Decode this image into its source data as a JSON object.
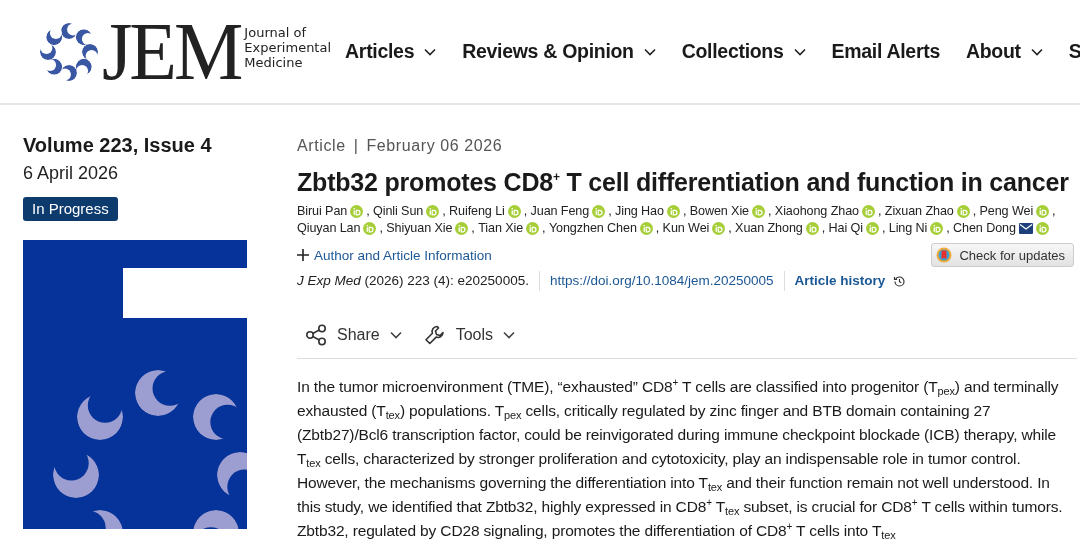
{
  "header": {
    "logo": {
      "mark": "JEM",
      "subtitle": [
        "Journal of",
        "Experimental",
        "Medicine"
      ]
    },
    "nav": [
      {
        "label": "Articles",
        "dropdown": true
      },
      {
        "label": "Reviews & Opinion",
        "dropdown": true
      },
      {
        "label": "Collections",
        "dropdown": true
      },
      {
        "label": "Email Alerts",
        "dropdown": false
      },
      {
        "label": "About",
        "dropdown": true
      },
      {
        "label": "S",
        "dropdown": false
      }
    ]
  },
  "issue": {
    "volume": "Volume 223, Issue 4",
    "date": "6 April 2026",
    "badge": "In Progress"
  },
  "article": {
    "type": "Article",
    "separator": "|",
    "date": "February 06 2026",
    "title": "Zbtb32 promotes CD8$^{+}$ T cell differentiation and function in cancer",
    "authors": [
      {
        "name": "Birui Pan",
        "email": false,
        "separator": ","
      },
      {
        "name": "Qinli Sun",
        "email": false,
        "separator": ","
      },
      {
        "name": "Ruifeng Li",
        "email": false,
        "separator": ","
      },
      {
        "name": "Juan Feng",
        "email": false,
        "separator": ","
      },
      {
        "name": "Jing Hao",
        "email": false,
        "separator": ","
      },
      {
        "name": "Bowen Xie",
        "email": false,
        "separator": ","
      },
      {
        "name": "Xiaohong Zhao",
        "email": false,
        "separator": ","
      },
      {
        "name": "Zixuan Zhao",
        "email": false,
        "separator": ","
      },
      {
        "name": "Peng Wei",
        "email": false,
        "separator": ","
      },
      {
        "name": "Qiuyan Lan",
        "email": false,
        "separator": ","
      },
      {
        "name": "Shiyuan Xie",
        "email": false,
        "separator": ","
      },
      {
        "name": "Tian Xie",
        "email": false,
        "separator": ","
      },
      {
        "name": "Yongzhen Chen",
        "email": false,
        "separator": ","
      },
      {
        "name": "Kun Wei",
        "email": false,
        "separator": ","
      },
      {
        "name": "Xuan Zhong",
        "email": false,
        "separator": ","
      },
      {
        "name": "Hai Qi",
        "email": false,
        "separator": ","
      },
      {
        "name": "Ling Ni",
        "email": false,
        "separator": ","
      },
      {
        "name": "Chen Dong",
        "email": true
      }
    ],
    "author_info": "Author and Article Information",
    "check_updates": "Check for updates",
    "citation": "*J Exp Med* (2026) 223 (4): e20250005.",
    "doi": "https://doi.org/10.1084/jem.20250005",
    "history": "Article history",
    "tools": [
      {
        "label": "Share",
        "kind": "share"
      },
      {
        "label": "Tools",
        "kind": "tools"
      }
    ],
    "abstract": "In the tumor microenvironment (TME), “exhausted” CD8$^{+}$ T cells are classified into progenitor (T$_{pex}$) and terminally exhausted (T$_{tex}$) populations. T$_{pex}$ cells, critically regulated by zinc finger and BTB domain containing 27 (Zbtb27)/Bcl6 transcription factor, could be reinvigorated during immune checkpoint blockade (ICB) therapy, while T$_{tex}$ cells, characterized by stronger proliferation and cytotoxicity, play an indispensable role in tumor control. However, the mechanisms governing the differentiation into T$_{tex}$ and their function remain not well understood. In this study, we identified that Zbtb32, highly expressed in CD8$^{+}$ T$_{tex}$ subset, is crucial for CD8$^{+}$ T cells within tumors. Zbtb32, regulated by CD28 signaling, promotes the differentiation of CD8$^{+}$ T cells into T$_{tex}$"
  }
}
